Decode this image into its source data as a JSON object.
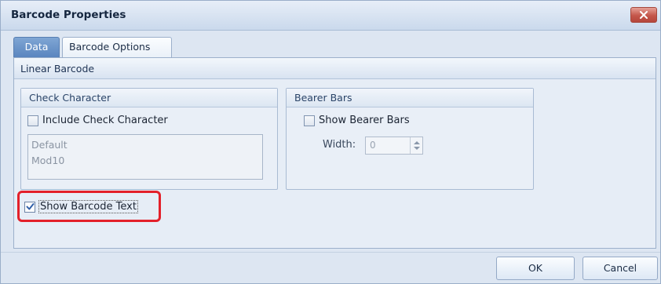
{
  "window": {
    "title": "Barcode Properties"
  },
  "tabs": [
    {
      "label": "Data",
      "active": true
    },
    {
      "label": "Barcode Options",
      "active": false
    }
  ],
  "panel": {
    "section_title": "Linear Barcode",
    "check_character": {
      "title": "Check Character",
      "include_label": "Include Check Character",
      "include_checked": false,
      "options": [
        "Default",
        "Mod10"
      ]
    },
    "bearer_bars": {
      "title": "Bearer Bars",
      "show_label": "Show Bearer Bars",
      "show_checked": false,
      "width_label": "Width:",
      "width_value": "0"
    },
    "show_text": {
      "label": "Show Barcode Text",
      "checked": true
    }
  },
  "buttons": {
    "ok": "OK",
    "cancel": "Cancel"
  },
  "colors": {
    "accent_tab": "#5a85bf",
    "highlight": "#e3202a",
    "close": "#c4564a"
  },
  "icons": [
    "close-icon",
    "checkmark-icon",
    "spin-up-icon",
    "spin-down-icon"
  ]
}
